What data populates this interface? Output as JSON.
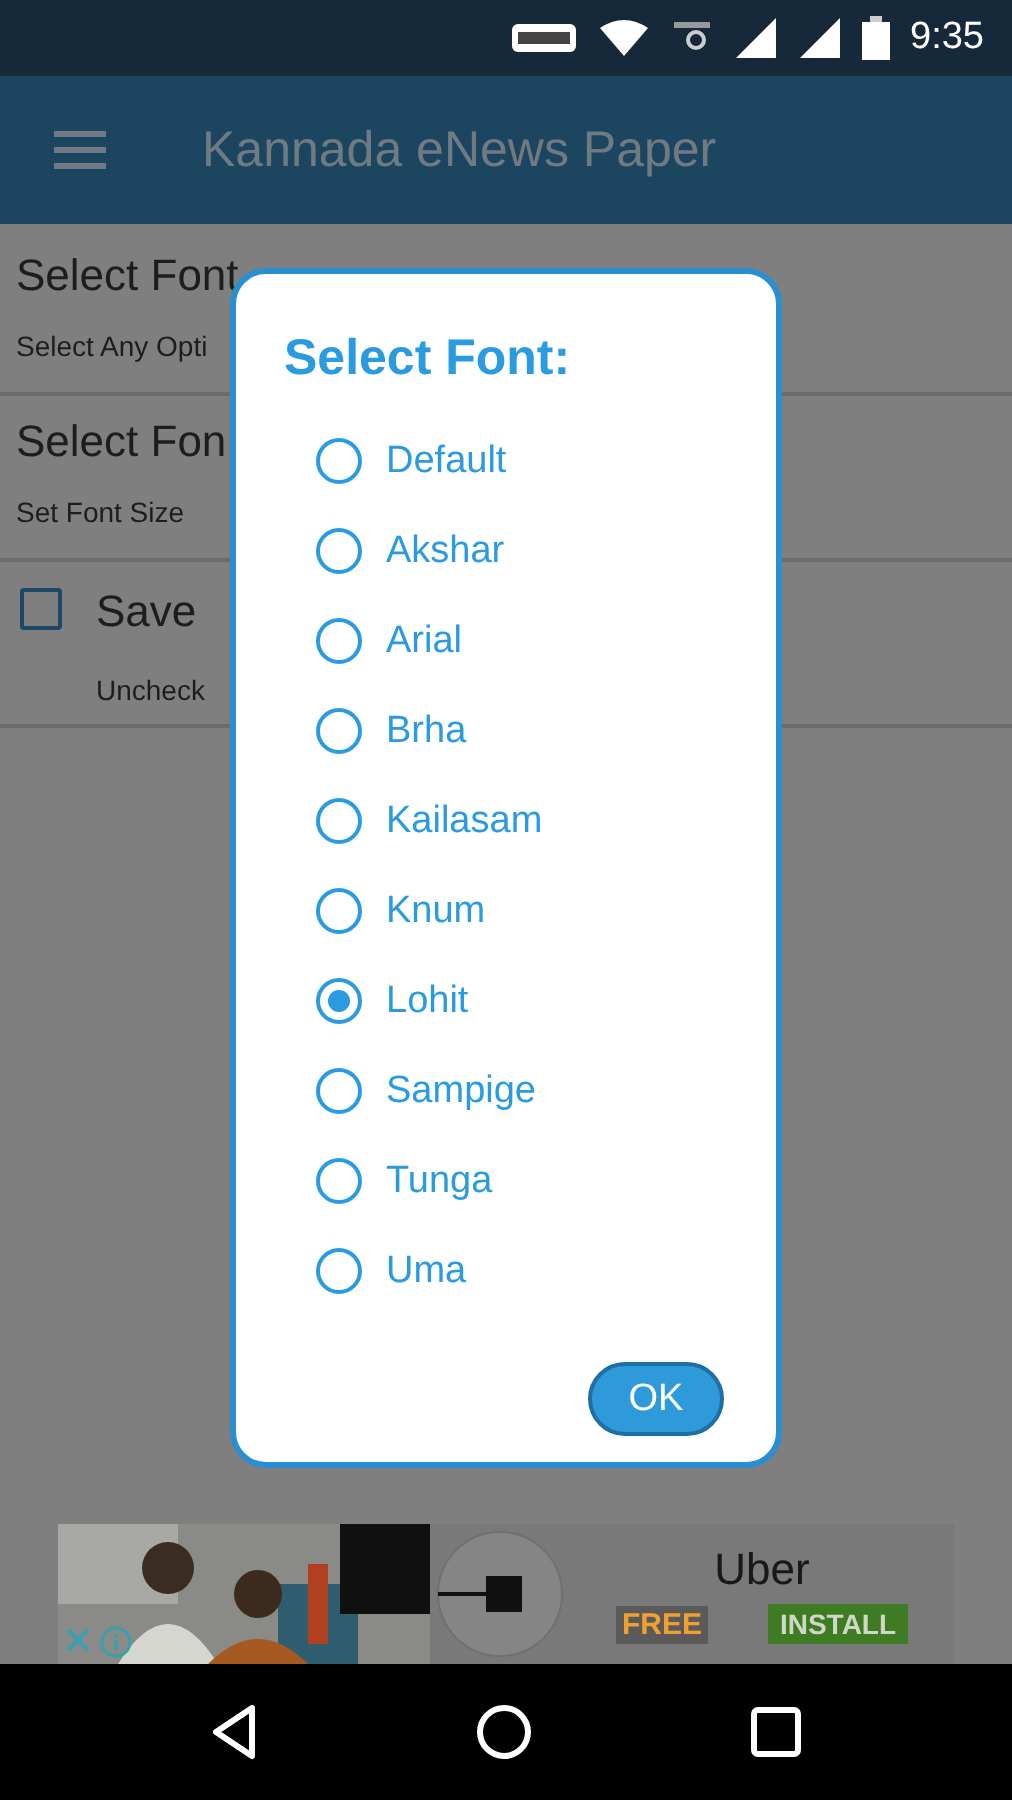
{
  "status_bar": {
    "time": "9:35"
  },
  "app_bar": {
    "title": "Kannada eNews Paper"
  },
  "settings": [
    {
      "kind": "text",
      "title": "Select Font",
      "subtitle": "Select Any Opti"
    },
    {
      "kind": "text",
      "title": "Select Fon",
      "subtitle": "Set Font Size"
    },
    {
      "kind": "checkbox",
      "checked": false,
      "title": "Save",
      "subtitle": "Uncheck"
    }
  ],
  "dialog": {
    "title": "Select Font:",
    "options": [
      {
        "label": "Default",
        "selected": false
      },
      {
        "label": "Akshar",
        "selected": false
      },
      {
        "label": "Arial",
        "selected": false
      },
      {
        "label": "Brha",
        "selected": false
      },
      {
        "label": "Kailasam",
        "selected": false
      },
      {
        "label": "Knum",
        "selected": false
      },
      {
        "label": "Lohit",
        "selected": true
      },
      {
        "label": "Sampige",
        "selected": false
      },
      {
        "label": "Tunga",
        "selected": false
      },
      {
        "label": "Uma",
        "selected": false
      }
    ],
    "ok": "OK"
  },
  "ad": {
    "kind": "picture",
    "app_name": "Uber",
    "price": "FREE",
    "install": "INSTALL"
  }
}
